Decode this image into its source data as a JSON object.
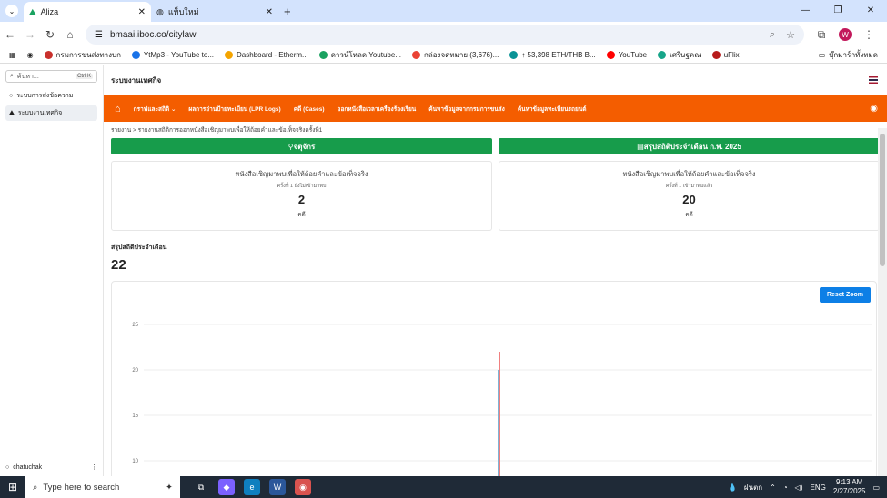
{
  "browser": {
    "tabs": [
      {
        "title": "Aliza",
        "active": true
      },
      {
        "title": "แท็บใหม่",
        "active": false
      }
    ],
    "url": "bmaai.iboc.co/citylaw",
    "profile_initial": "W",
    "bookmarks": [
      {
        "label": "กรมการขนส่งทางบก",
        "color": "#c9302c"
      },
      {
        "label": "YtMp3 - YouTube to...",
        "color": "#1a73e8"
      },
      {
        "label": "Dashboard - Etherm...",
        "color": "#f4a400"
      },
      {
        "label": "ดาวน์โหลด Youtube...",
        "color": "#1aa260"
      },
      {
        "label": "กล่องจดหมาย (3,676)...",
        "color": "#ea4335"
      },
      {
        "label": "↑ 53,398 ETH/THB B...",
        "color": "#0a9396"
      },
      {
        "label": "YouTube",
        "color": "#ff0000"
      },
      {
        "label": "เศรีษฐคณ",
        "color": "#17a589"
      },
      {
        "label": "uFlix",
        "color": "#b71c1c"
      }
    ],
    "all_bookmarks": "บุ๊กมาร์กทั้งหมด"
  },
  "sidebar": {
    "search_placeholder": "ค้นหา...",
    "shortcut": "Ctrl K",
    "items": [
      {
        "label": "ระบบการส่งข้อความ",
        "selected": false
      },
      {
        "label": "ระบบงานเทศกิจ",
        "selected": true
      }
    ],
    "footer_user": "chatuchak"
  },
  "header": {
    "title": "ระบบงานเทศกิจ"
  },
  "nav": {
    "items": [
      "กราฟและสถิติ",
      "ผลการอ่านป้ายทะเบียน (LPR Logs)",
      "คดี (Cases)",
      "ออกหนังสือเวลาเครื่องร้องเรียน",
      "ค้นหาข้อมูลจากกรมการขนส่ง",
      "ค้นหาข้อมูลทะเบียนรถยนต์"
    ]
  },
  "breadcrumb": "รายงาน > รายงานสถิติการออกหนังสือเชิญมาพบเพื่อให้ถ้อยคำและข้อเท็จจริงครั้งที่1",
  "filters": {
    "location": "จตุจักร",
    "month": "สรุปสถิติประจำเดือน ก.พ. 2025"
  },
  "cards": [
    {
      "title": "หนังสือเชิญมาพบเพื่อให้ถ้อยคำและข้อเท็จจริง",
      "subtitle": "ครั้งที่ 1 ยังไม่เข้ามาพบ",
      "value": "2",
      "unit": "คดี"
    },
    {
      "title": "หนังสือเชิญมาพบเพื่อให้ถ้อยคำและข้อเท็จจริง",
      "subtitle": "ครั้งที่ 1 เข้ามาพบแล้ว",
      "value": "20",
      "unit": "คดี"
    }
  ],
  "summary": {
    "label": "สรุปสถิติประจำเดือน",
    "value": "22"
  },
  "reset_zoom": "Reset Zoom",
  "chart_data": {
    "type": "bar",
    "categories": [
      ""
    ],
    "series": [
      {
        "values": [
          20
        ],
        "color": "#7fb3d5"
      },
      {
        "values": [
          22
        ],
        "color": "#f08080"
      }
    ],
    "yticks": [
      10,
      15,
      20,
      25
    ],
    "ylim": [
      5,
      25
    ],
    "grid": true
  },
  "taskbar": {
    "search_placeholder": "Type here to search",
    "weather": "ฝนตก",
    "lang": "ENG",
    "time": "9:13 AM",
    "date": "2/27/2025"
  }
}
